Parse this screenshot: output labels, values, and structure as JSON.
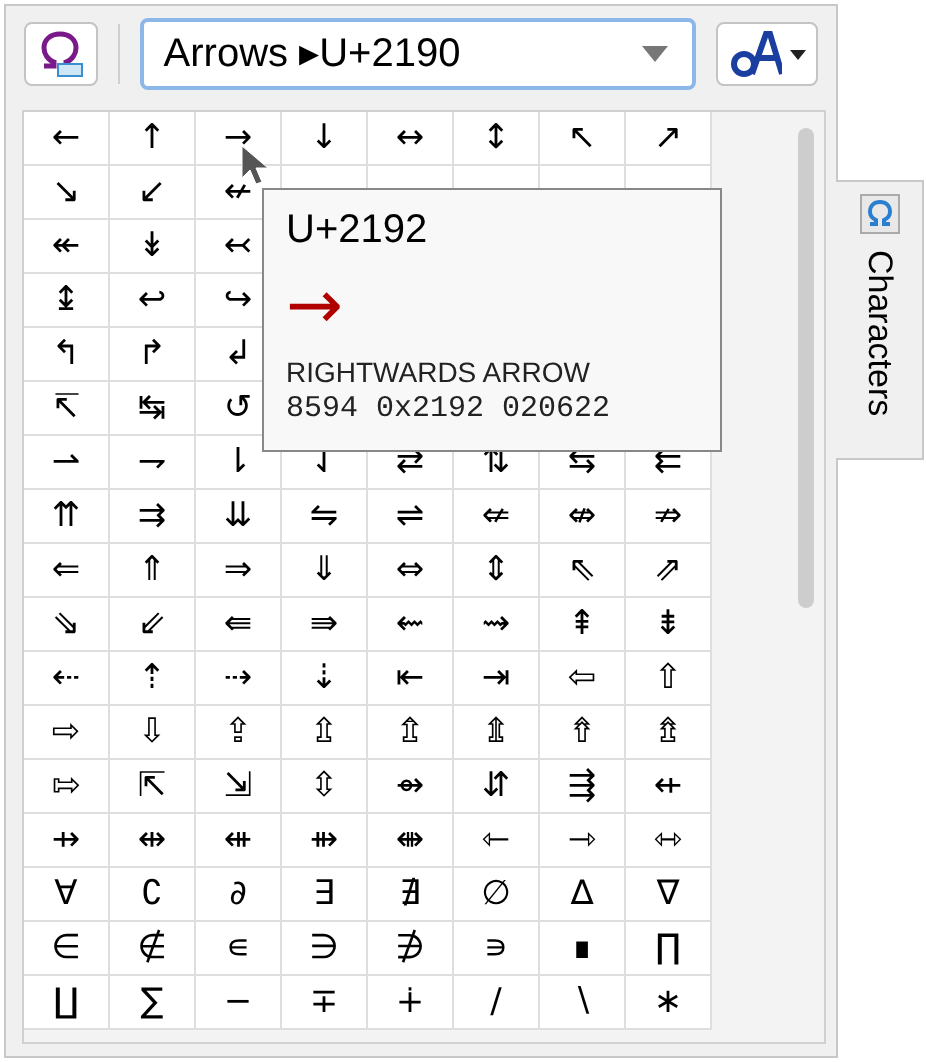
{
  "toolbar": {
    "block_select": {
      "value": "Arrows ▸U+2190"
    }
  },
  "grid": {
    "rows": [
      [
        "←",
        "↑",
        "→",
        "↓",
        "↔",
        "↕",
        "↖",
        "↗"
      ],
      [
        "↘",
        "↙",
        "↚"
      ],
      [
        "↞",
        "↡",
        "↢"
      ],
      [
        "↨",
        "↩",
        "↪"
      ],
      [
        "↰",
        "↱",
        "↲"
      ],
      [
        "↸",
        "↹",
        "↺"
      ],
      [
        "⇀",
        "⇁",
        "⇂",
        "⇃",
        "⇄",
        "⇅",
        "⇆",
        "⇇"
      ],
      [
        "⇈",
        "⇉",
        "⇊",
        "⇋",
        "⇌",
        "⇍",
        "⇎",
        "⇏"
      ],
      [
        "⇐",
        "⇑",
        "⇒",
        "⇓",
        "⇔",
        "⇕",
        "⇖",
        "⇗"
      ],
      [
        "⇘",
        "⇙",
        "⇚",
        "⇛",
        "⇜",
        "⇝",
        "⇞",
        "⇟"
      ],
      [
        "⇠",
        "⇡",
        "⇢",
        "⇣",
        "⇤",
        "⇥",
        "⇦",
        "⇧"
      ],
      [
        "⇨",
        "⇩",
        "⇪",
        "⇫",
        "⇬",
        "⇭",
        "⇮",
        "⇯"
      ],
      [
        "⇰",
        "⇱",
        "⇲",
        "⇳",
        "⇴",
        "⇵",
        "⇶",
        "⇷"
      ],
      [
        "⇸",
        "⇹",
        "⇺",
        "⇻",
        "⇼",
        "⇽",
        "⇾",
        "⇿"
      ],
      [
        "∀",
        "∁",
        "∂",
        "∃",
        "∄",
        "∅",
        "∆",
        "∇"
      ],
      [
        "∈",
        "∉",
        "∊",
        "∋",
        "∌",
        "∍",
        "∎",
        "∏"
      ],
      [
        "∐",
        "∑",
        "−",
        "∓",
        "∔",
        "∕",
        "∖",
        "∗"
      ]
    ]
  },
  "tooltip": {
    "code": "U+2192",
    "glyph": "→",
    "name": "RIGHTWARDS ARROW",
    "values": "8594 0x2192 020622"
  },
  "side_tab": {
    "label": "Characters",
    "selected": true
  }
}
